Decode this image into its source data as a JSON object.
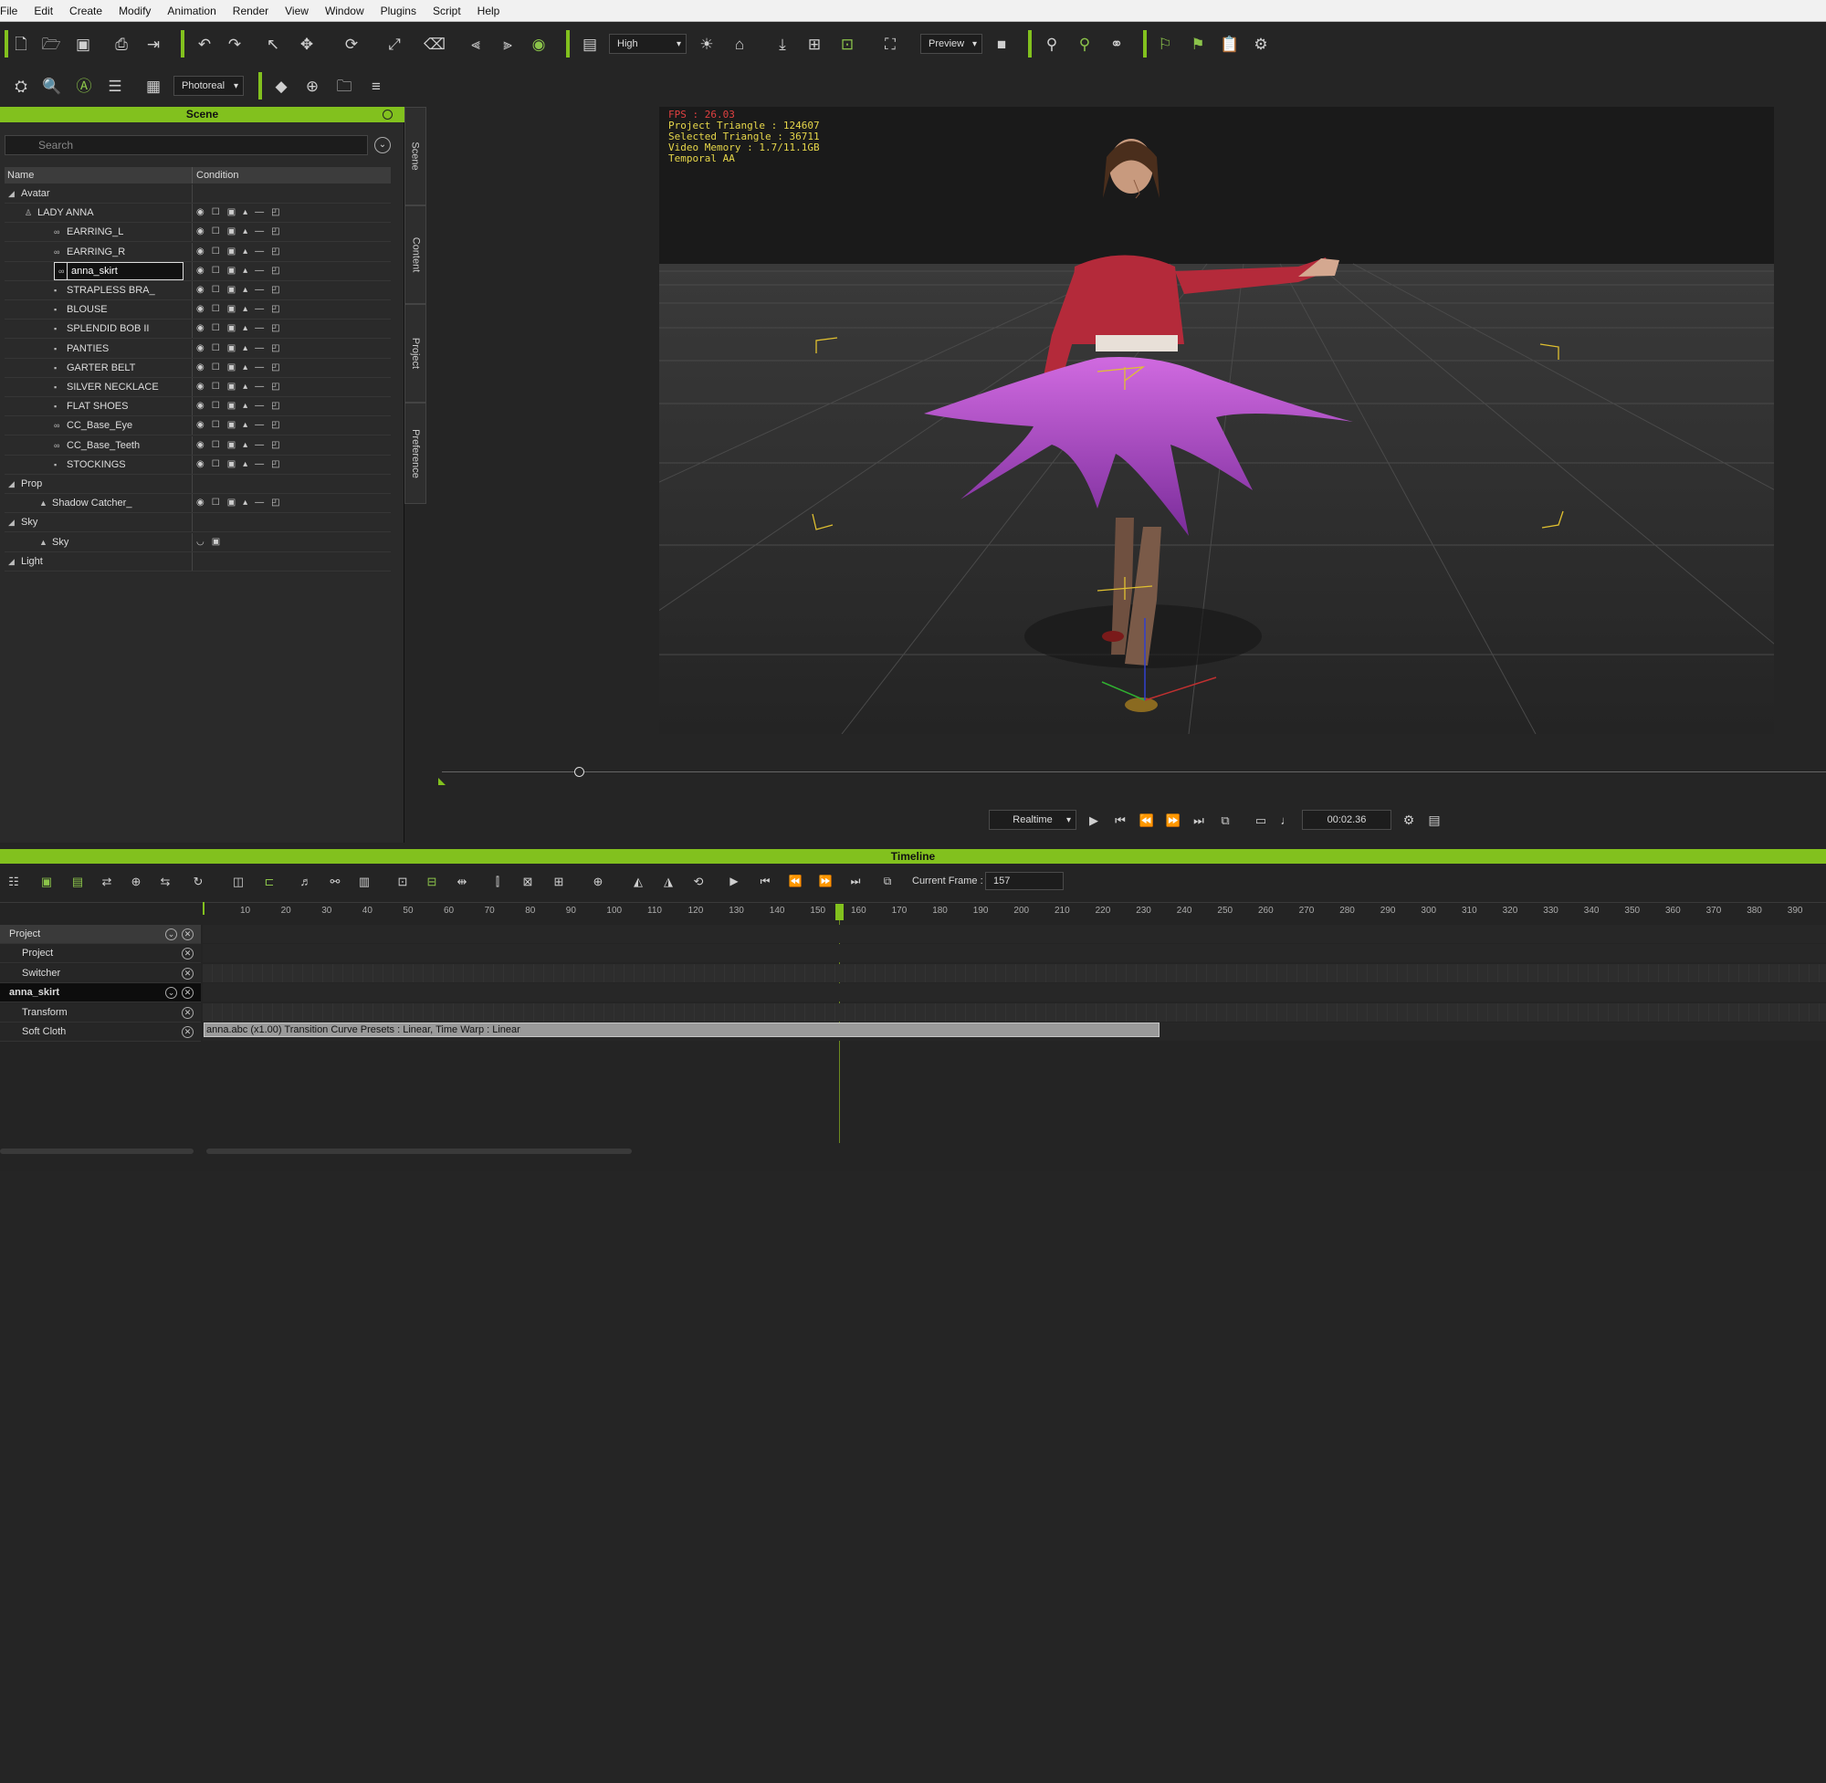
{
  "menu": [
    "File",
    "Edit",
    "Create",
    "Modify",
    "Animation",
    "Render",
    "View",
    "Window",
    "Plugins",
    "Script",
    "Help"
  ],
  "toolbar": {
    "quality": "High",
    "preview": "Preview",
    "render_mode": "Photoreal"
  },
  "scene": {
    "title": "Scene",
    "search_placeholder": "Search",
    "col_name": "Name",
    "col_condition": "Condition",
    "rows": [
      {
        "label": "Avatar",
        "kind": "group"
      },
      {
        "label": "LADY ANNA",
        "kind": "avatar"
      },
      {
        "label": "EARRING_L",
        "kind": "acc"
      },
      {
        "label": "EARRING_R",
        "kind": "acc"
      },
      {
        "label": "anna_skirt",
        "kind": "acc",
        "selected": true
      },
      {
        "label": "STRAPLESS BRA_",
        "kind": "cloth"
      },
      {
        "label": "BLOUSE",
        "kind": "cloth"
      },
      {
        "label": "SPLENDID BOB II",
        "kind": "cloth"
      },
      {
        "label": "PANTIES",
        "kind": "cloth"
      },
      {
        "label": "GARTER BELT",
        "kind": "cloth"
      },
      {
        "label": "SILVER NECKLACE",
        "kind": "cloth"
      },
      {
        "label": "FLAT SHOES",
        "kind": "cloth"
      },
      {
        "label": "CC_Base_Eye",
        "kind": "acc"
      },
      {
        "label": "CC_Base_Teeth",
        "kind": "acc"
      },
      {
        "label": "STOCKINGS",
        "kind": "cloth"
      },
      {
        "label": "Prop",
        "kind": "group"
      },
      {
        "label": "Shadow Catcher_",
        "kind": "prop"
      },
      {
        "label": "Sky",
        "kind": "group"
      },
      {
        "label": "Sky",
        "kind": "prop"
      },
      {
        "label": "Light",
        "kind": "group"
      }
    ]
  },
  "side_tabs": [
    "Scene",
    "Content",
    "Project",
    "Preference"
  ],
  "viewport": {
    "fps": "FPS : 26.03",
    "project_triangle": "Project Triangle : 124607",
    "selected_triangle": "Selected Triangle : 36711",
    "video_memory": "Video Memory : 1.7/11.1GB",
    "aa": "Temporal AA"
  },
  "playback": {
    "mode": "Realtime",
    "time": "00:02.36"
  },
  "timeline": {
    "title": "Timeline",
    "current_frame_label": "Current Frame :",
    "current_frame": "157",
    "ticks": [
      "10",
      "20",
      "30",
      "40",
      "50",
      "60",
      "70",
      "80",
      "90",
      "100",
      "110",
      "120",
      "130",
      "140",
      "150",
      "160",
      "170",
      "180",
      "190",
      "200",
      "210",
      "220",
      "230",
      "240",
      "250",
      "260",
      "270",
      "280",
      "290",
      "300",
      "310",
      "320",
      "330",
      "340",
      "350",
      "360",
      "370",
      "380",
      "390"
    ],
    "tracks": [
      {
        "label": "Project",
        "level": 0
      },
      {
        "label": "Project",
        "level": 1
      },
      {
        "label": "Switcher",
        "level": 1
      },
      {
        "label": "anna_skirt",
        "level": 0
      },
      {
        "label": "Transform",
        "level": 1
      },
      {
        "label": "Soft Cloth",
        "level": 1
      }
    ],
    "clip": "anna.abc (x1.00) Transition Curve Presets : Linear, Time Warp : Linear"
  },
  "colors": {
    "accent": "#82c11e",
    "skirt": "#b050c8",
    "stats": "#e6d64a",
    "fps": "#e04040"
  }
}
